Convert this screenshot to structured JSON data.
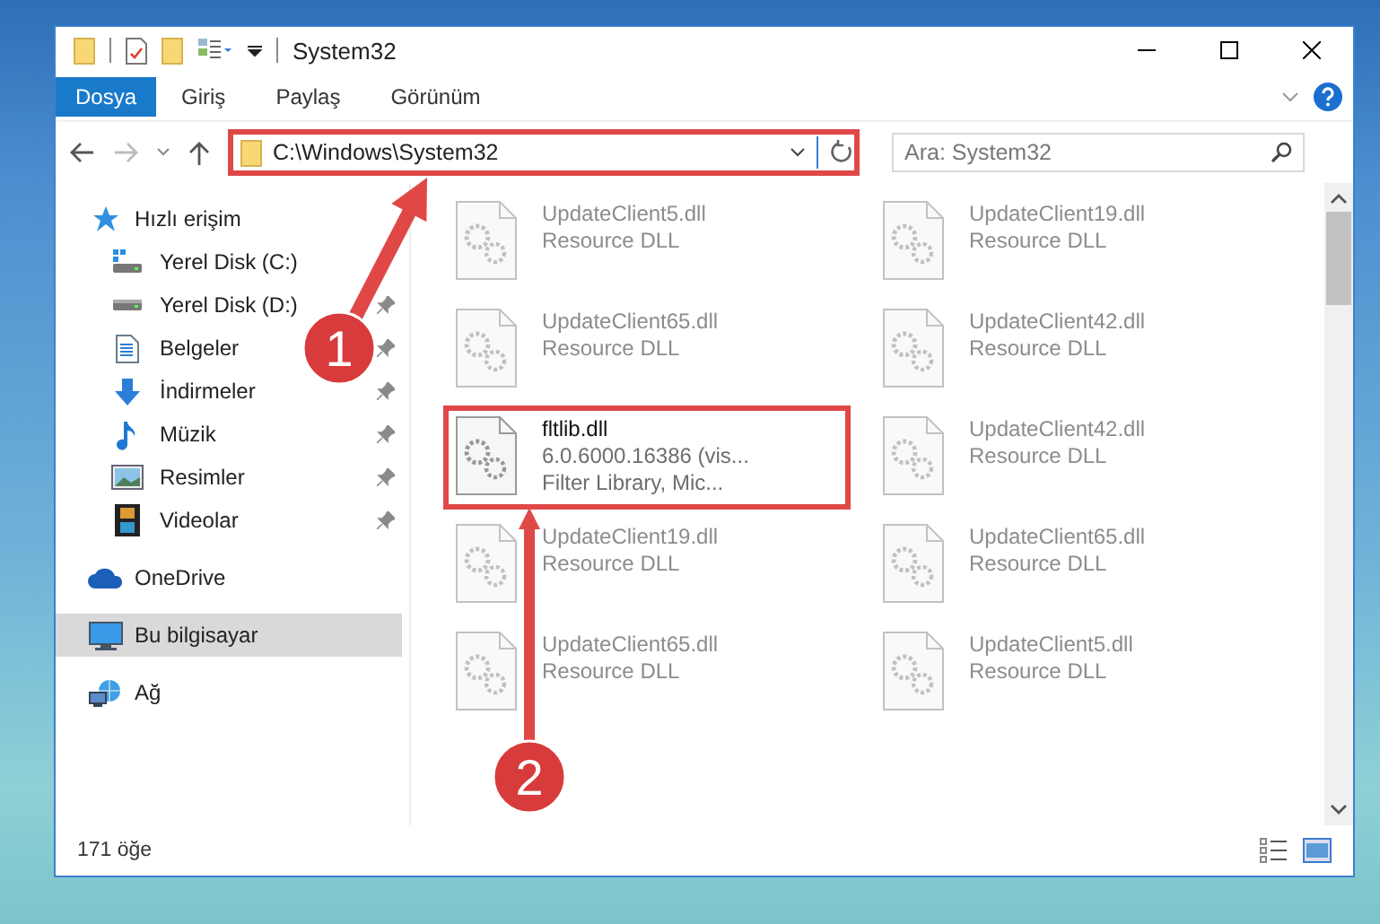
{
  "window": {
    "title": "System32"
  },
  "ribbon_tabs": [
    {
      "label": "Dosya",
      "selected": true
    },
    {
      "label": "Giriş",
      "selected": false
    },
    {
      "label": "Paylaş",
      "selected": false
    },
    {
      "label": "Görünüm",
      "selected": false
    }
  ],
  "address_bar": {
    "path": "C:\\Windows\\System32",
    "highlighted": true
  },
  "search": {
    "placeholder": "Ara: System32"
  },
  "sidebar": {
    "items": [
      {
        "label": "Hızlı erişim",
        "selected": false,
        "children": [
          {
            "label": "Yerel Disk (C:)",
            "pinned": false,
            "selected": false
          },
          {
            "label": "Yerel Disk (D:)",
            "pinned": true,
            "selected": false
          },
          {
            "label": "Belgeler",
            "pinned": true,
            "selected": false
          },
          {
            "label": "İndirmeler",
            "pinned": true,
            "selected": false
          },
          {
            "label": "Müzik",
            "pinned": true,
            "selected": false
          },
          {
            "label": "Resimler",
            "pinned": true,
            "selected": false
          },
          {
            "label": "Videolar",
            "pinned": true,
            "selected": false
          }
        ]
      },
      {
        "label": "OneDrive",
        "selected": false
      },
      {
        "label": "Bu bilgisayar",
        "selected": true
      },
      {
        "label": "Ağ",
        "selected": false
      }
    ]
  },
  "files": [
    {
      "name": "UpdateClient5.dll",
      "details": [
        "Resource DLL"
      ],
      "blurred": true,
      "highlighted": false
    },
    {
      "name": "UpdateClient19.dll",
      "details": [
        "Resource DLL"
      ],
      "blurred": true,
      "highlighted": false
    },
    {
      "name": "UpdateClient65.dll",
      "details": [
        "Resource DLL"
      ],
      "blurred": true,
      "highlighted": false
    },
    {
      "name": "UpdateClient42.dll",
      "details": [
        "Resource DLL"
      ],
      "blurred": true,
      "highlighted": false
    },
    {
      "name": "fltlib.dll",
      "details": [
        "6.0.6000.16386 (vis...",
        "Filter Library, Mic..."
      ],
      "blurred": false,
      "highlighted": true
    },
    {
      "name": "UpdateClient42.dll",
      "details": [
        "Resource DLL"
      ],
      "blurred": true,
      "highlighted": false
    },
    {
      "name": "UpdateClient19.dll",
      "details": [
        "Resource DLL"
      ],
      "blurred": true,
      "highlighted": false
    },
    {
      "name": "UpdateClient65.dll",
      "details": [
        "Resource DLL"
      ],
      "blurred": true,
      "highlighted": false
    },
    {
      "name": "UpdateClient65.dll",
      "details": [
        "Resource DLL"
      ],
      "blurred": true,
      "highlighted": false
    },
    {
      "name": "UpdateClient5.dll",
      "details": [
        "Resource DLL"
      ],
      "blurred": true,
      "highlighted": false
    }
  ],
  "status_bar": {
    "item_count": "171 öğe"
  },
  "annotations": [
    {
      "label": "1"
    },
    {
      "label": "2"
    }
  ]
}
